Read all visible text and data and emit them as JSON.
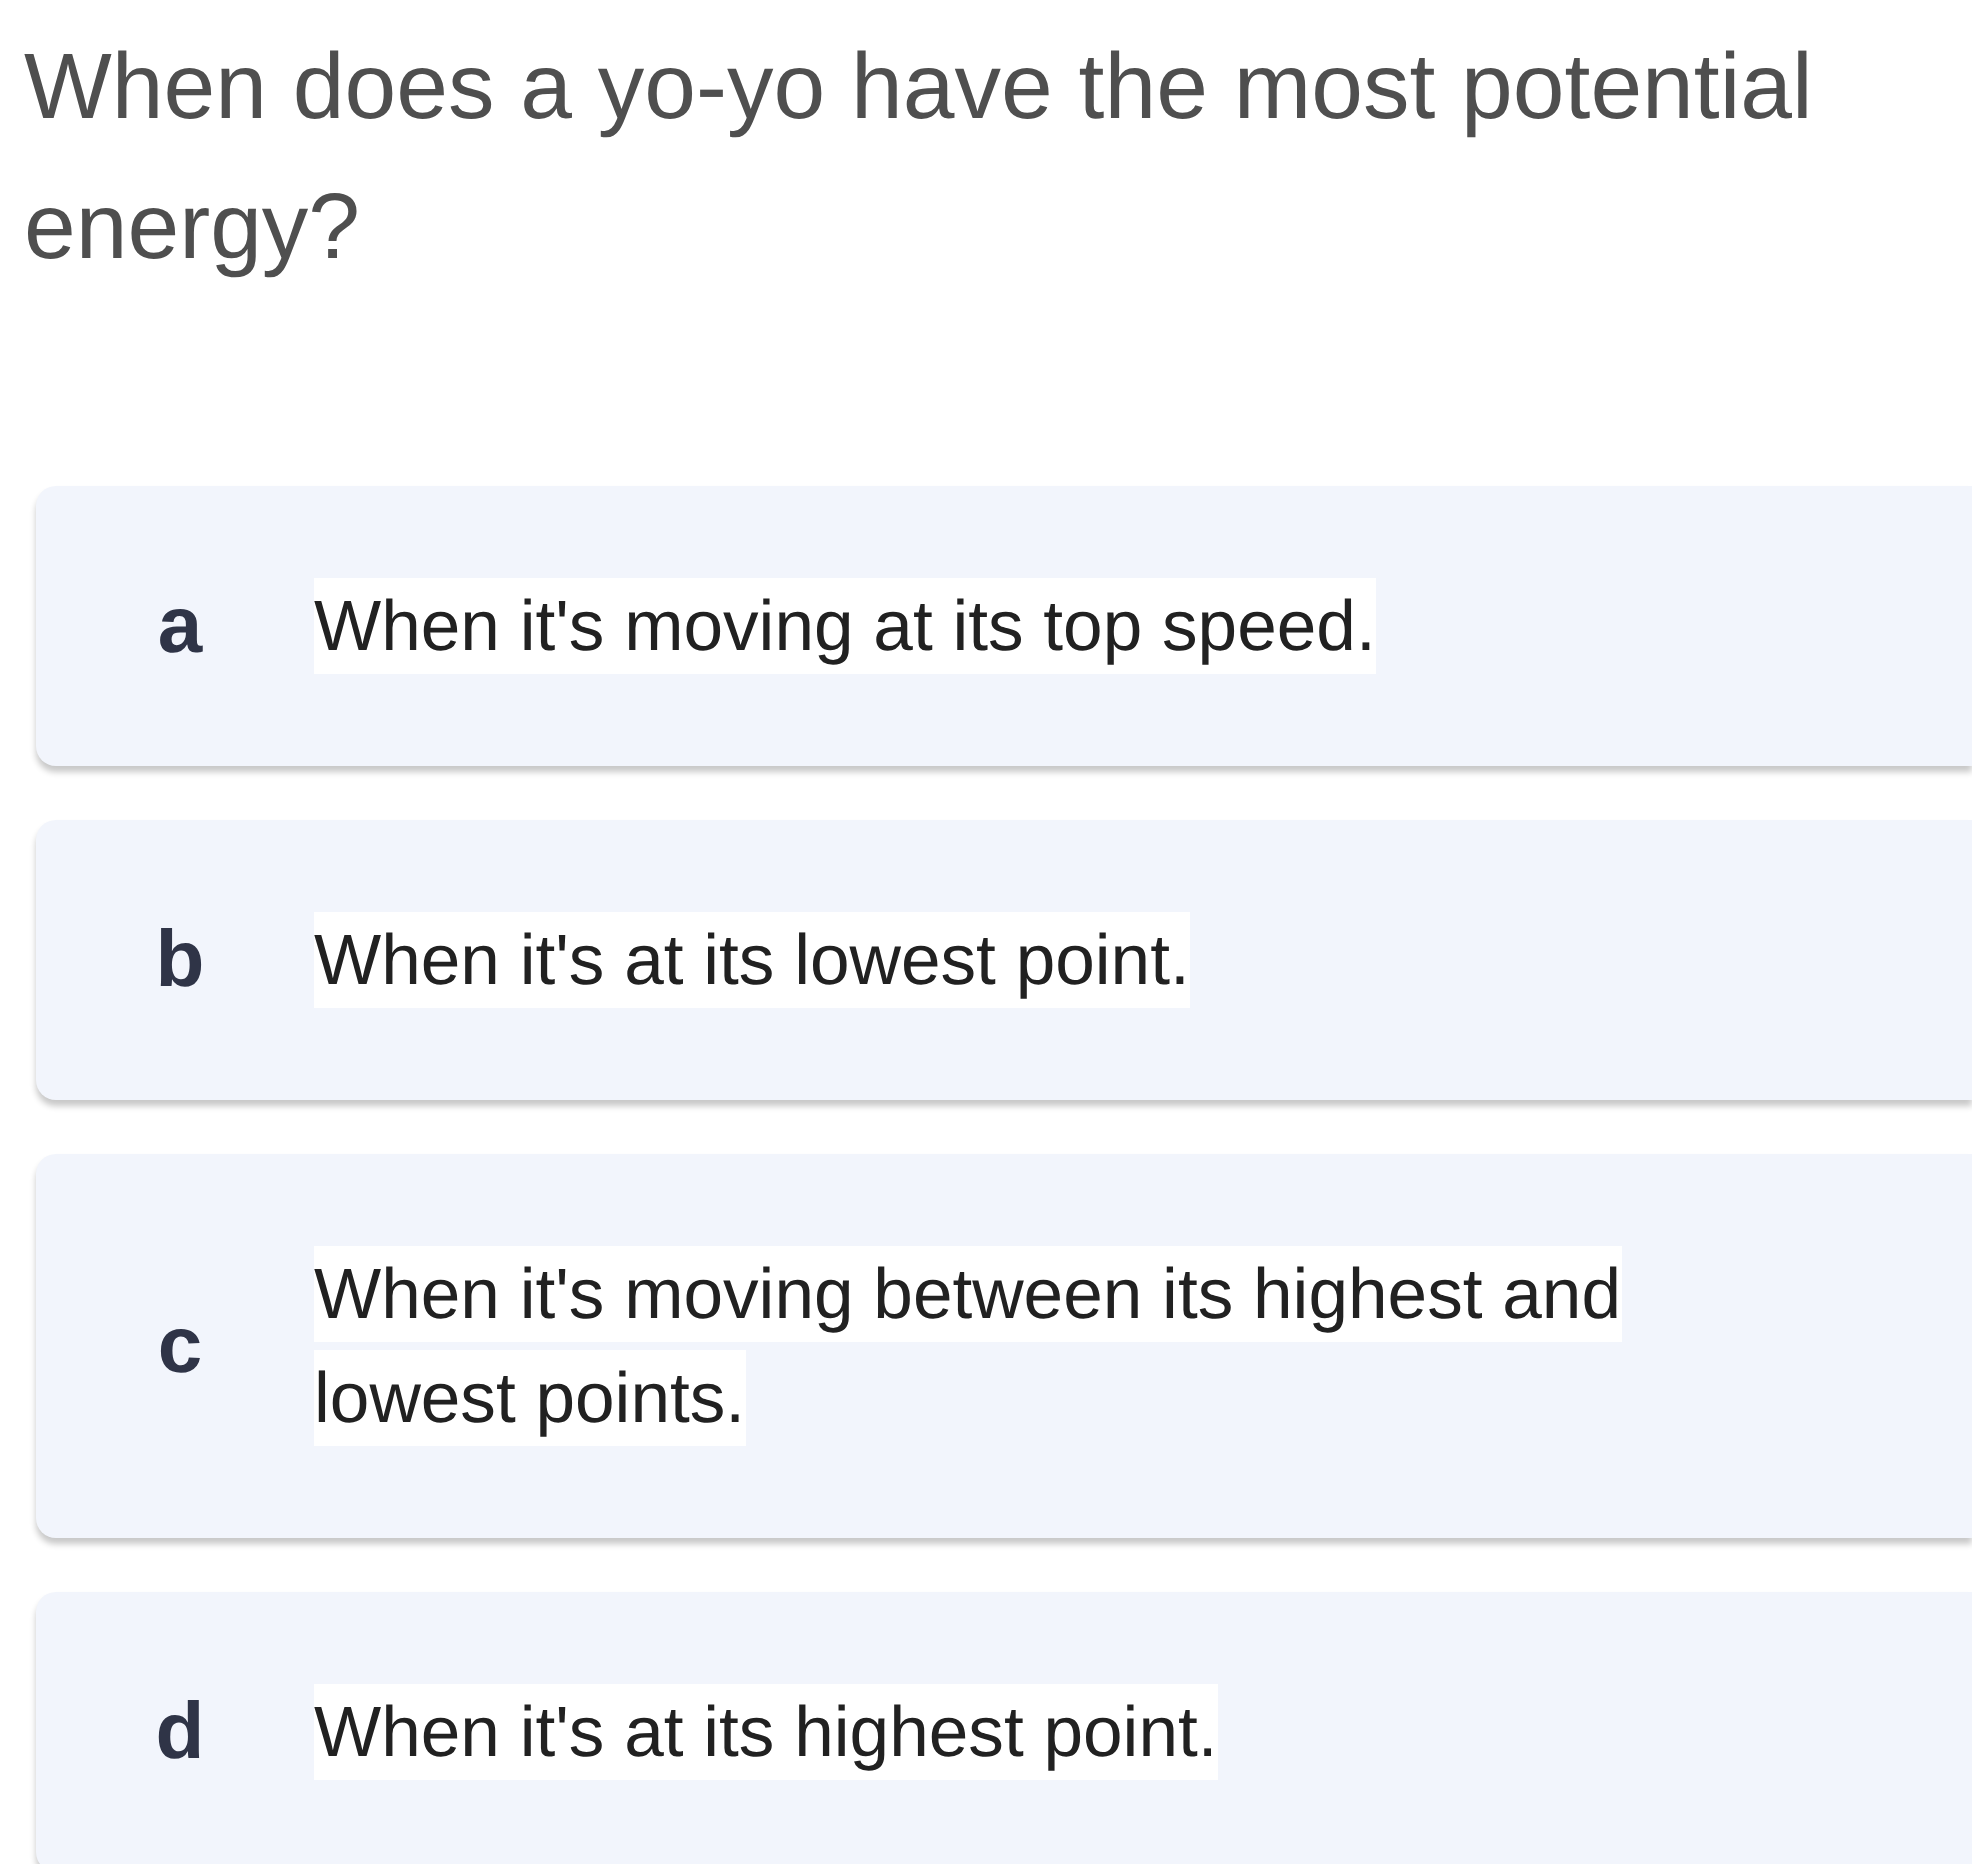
{
  "question": "When does a yo-yo have the most potential energy?",
  "options": [
    {
      "letter": "a",
      "text": "When it's moving at its top speed."
    },
    {
      "letter": "b",
      "text": "When it's at its lowest point."
    },
    {
      "letter": "c",
      "text": "When it's moving between its highest and lowest points."
    },
    {
      "letter": "d",
      "text": "When it's at its highest point."
    }
  ]
}
